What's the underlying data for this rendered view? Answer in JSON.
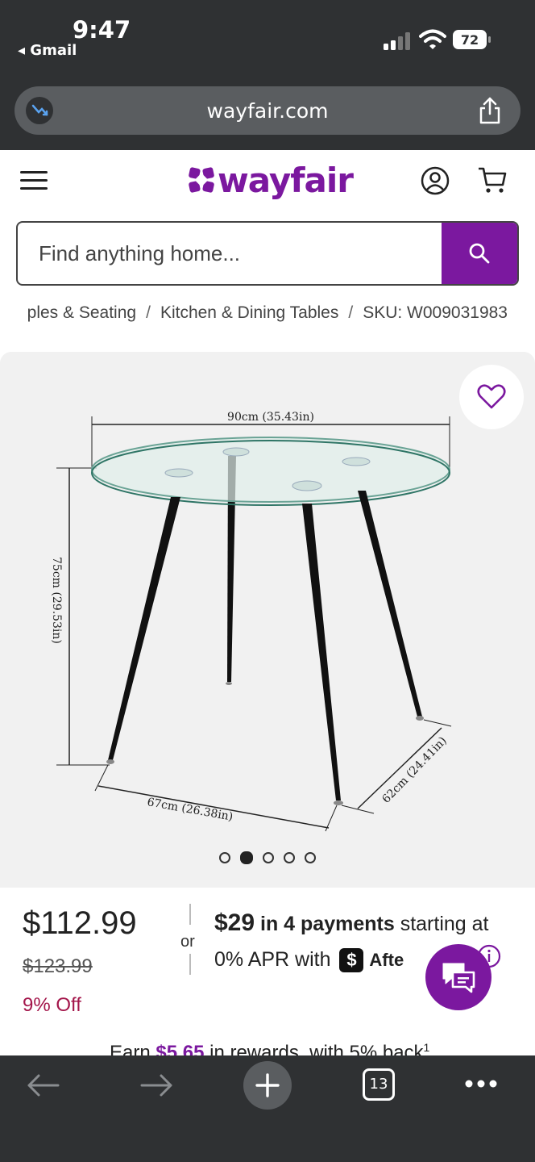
{
  "status_bar": {
    "time": "9:47",
    "back_app": "◂ Gmail",
    "battery": "72"
  },
  "url_bar": {
    "url": "wayfair.com"
  },
  "header": {
    "logo": "wayfair"
  },
  "search": {
    "placeholder": "Find anything home..."
  },
  "breadcrumb": {
    "items": [
      "ples & Seating",
      "Kitchen & Dining Tables",
      "SKU: W009031983"
    ]
  },
  "gallery": {
    "dimension_width": "90cm (35.43in)",
    "dimension_height": "75cm (29.53in)",
    "dimension_depth_left": "67cm (26.38in)",
    "dimension_depth_right": "62cm (24.41in)",
    "image_count": 5,
    "active_image": 2
  },
  "pricing": {
    "price": "$112.99",
    "old_price": "$123.99",
    "discount": "9% Off",
    "or": "or",
    "installment_amount": "$29",
    "installment_text": "in 4 payments",
    "installment_tail": "starting at 0% APR with",
    "afterpay_mark": "$",
    "afterpay_name": "Afte"
  },
  "rewards": {
    "prefix": "Earn ",
    "amount": "$5.65",
    "suffix": " in rewards, with 5% back",
    "footnote": "1"
  },
  "bottom_bar": {
    "tab_count": "13"
  },
  "colors": {
    "brand": "#7b189f",
    "discount": "#a3154a",
    "chrome": "#2f3133"
  }
}
